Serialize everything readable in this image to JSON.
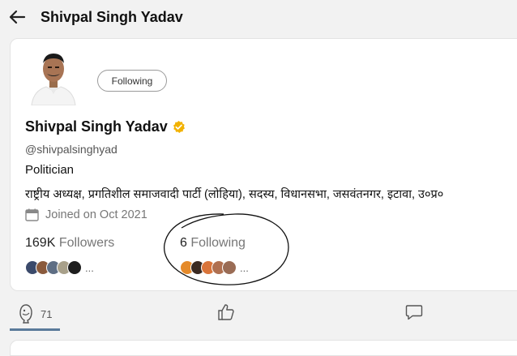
{
  "header": {
    "title": "Shivpal Singh Yadav"
  },
  "profile": {
    "follow_button": "Following",
    "name": "Shivpal Singh Yadav",
    "handle": "@shivpalsinghyad",
    "role": "Politician",
    "bio": "राष्ट्रीय अध्यक्ष, प्रगतिशील समाजवादी पार्टी (लोहिया), सदस्य, विधानसभा, जसवंतनगर, इटावा, उ०प्र०",
    "joined": "Joined on Oct 2021",
    "followers_count": "169K",
    "followers_label": "Followers",
    "following_count": "6",
    "following_label": "Following",
    "followers_more": "...",
    "following_more": "..."
  },
  "tabs": [
    {
      "icon": "koo-bird-icon",
      "count": "71"
    },
    {
      "icon": "thumbs-up-icon"
    },
    {
      "icon": "comment-icon"
    }
  ],
  "colors": {
    "verified": "#f2b200",
    "annotation": "#111111",
    "active_tab_underline": "#5a7a9a"
  }
}
